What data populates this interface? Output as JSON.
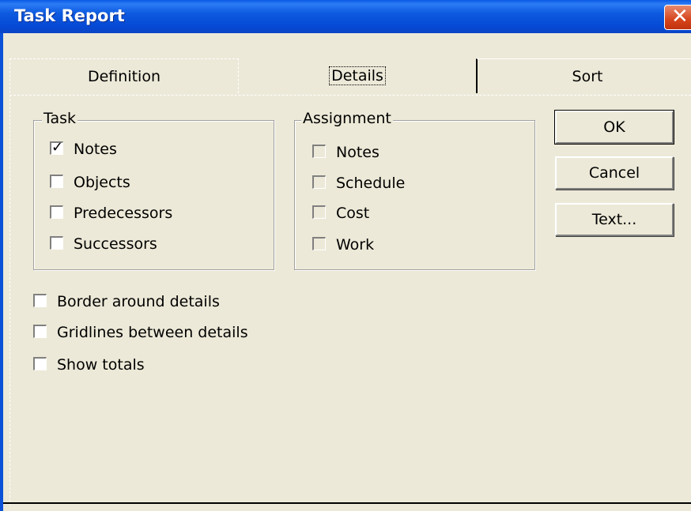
{
  "window": {
    "title": "Task Report",
    "close_icon": "close-icon"
  },
  "tabs": [
    {
      "label": "Definition"
    },
    {
      "label": "Details"
    },
    {
      "label": "Sort"
    }
  ],
  "task_group": {
    "label": "Task",
    "items": [
      {
        "label": "Notes",
        "checked": true
      },
      {
        "label": "Objects",
        "checked": false
      },
      {
        "label": "Predecessors",
        "checked": false
      },
      {
        "label": "Successors",
        "checked": false
      }
    ]
  },
  "assignment_group": {
    "label": "Assignment",
    "items": [
      {
        "label": "Notes",
        "checked": false
      },
      {
        "label": "Schedule",
        "checked": false
      },
      {
        "label": "Cost",
        "checked": false
      },
      {
        "label": "Work",
        "checked": false
      }
    ]
  },
  "options": [
    {
      "label": "Border around details",
      "checked": false
    },
    {
      "label": "Gridlines between details",
      "checked": false
    },
    {
      "label": "Show totals",
      "checked": false
    }
  ],
  "buttons": {
    "ok": "OK",
    "cancel": "Cancel",
    "text": "Text..."
  },
  "colors": {
    "titlebar": "#0a5ae6",
    "dialog_bg": "#ece9d8",
    "close": "#d6441b"
  }
}
